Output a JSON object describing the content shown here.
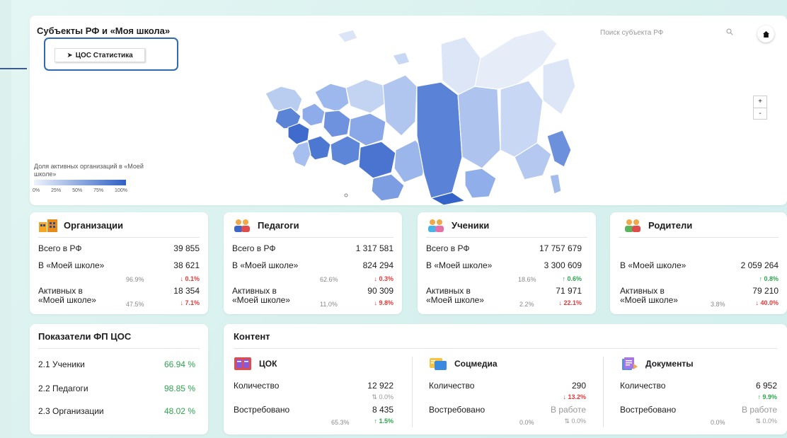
{
  "map": {
    "title": "Субъекты РФ и «Моя школа»",
    "cos_button_label": "ЦОС Статистика",
    "search_placeholder": "Поиск субъекта РФ",
    "zoom_in": "+",
    "zoom_out": "-",
    "legend_title": "Доля активных организаций в «Моей школе»",
    "legend_ticks": [
      "0%",
      "25%",
      "50%",
      "75%",
      "100%"
    ],
    "colors": {
      "low": "#eef3fb",
      "high": "#2f60c4"
    }
  },
  "stats": [
    {
      "title": "Организации",
      "icon": "building-icon",
      "total_label": "Всего в РФ",
      "total_value": "39 855",
      "in_label": "В «Моей школе»",
      "in_value": "38 621",
      "in_pct": "96.9%",
      "in_change": "0.1%",
      "active_label_1": "Активных в",
      "active_label_2": "«Моей школе»",
      "active_value": "18 354",
      "active_pct": "47.5%",
      "active_change": "7.1%"
    },
    {
      "title": "Педагоги",
      "icon": "teachers-icon",
      "total_label": "Всего в РФ",
      "total_value": "1 317 581",
      "in_label": "В «Моей школе»",
      "in_value": "824 294",
      "in_pct": "62.6%",
      "in_change": "0.3%",
      "active_label_1": "Активных в",
      "active_label_2": "«Моей школе»",
      "active_value": "90 309",
      "active_pct": "11.0%",
      "active_change": "9.8%"
    },
    {
      "title": "Ученики",
      "icon": "students-icon",
      "total_label": "Всего в РФ",
      "total_value": "17 757 679",
      "in_label": "В «Моей школе»",
      "in_value": "3 300 609",
      "in_pct": "18.6%",
      "in_change": "0.6%",
      "active_label_1": "Активных в",
      "active_label_2": "«Моей школе»",
      "active_value": "71 971",
      "active_pct": "2.2%",
      "active_change": "22.1%"
    },
    {
      "title": "Родители",
      "icon": "parents-icon",
      "in_label": "В «Моей школе»",
      "in_value": "2 059 264",
      "in_change": "0.8%",
      "active_label_1": "Активных в",
      "active_label_2": "«Моей школе»",
      "active_value": "79 210",
      "active_pct": "3.8%",
      "active_change": "40.0%"
    }
  ],
  "indicators": {
    "title": "Показатели ФП ЦОС",
    "rows": [
      {
        "label": "2.1 Ученики",
        "value": "66.94 %"
      },
      {
        "label": "2.2 Педагоги",
        "value": "98.85 %"
      },
      {
        "label": "2.3 Организации",
        "value": "48.02 %"
      }
    ]
  },
  "content": {
    "title": "Контент",
    "columns": [
      {
        "title": "ЦОК",
        "icon": "book-icon",
        "count_label": "Количество",
        "count_value": "12 922",
        "count_change": "0.0%",
        "demand_label": "Востребовано",
        "demand_value": "8 435",
        "demand_pct": "65.3%",
        "demand_change": "1.5%"
      },
      {
        "title": "Соцмедиа",
        "icon": "media-icon",
        "count_label": "Количество",
        "count_value": "290",
        "count_change": "13.2%",
        "demand_label": "Востребовано",
        "demand_value": "В работе",
        "demand_pct": "0.0%",
        "demand_change": "0.0%"
      },
      {
        "title": "Документы",
        "icon": "documents-icon",
        "count_label": "Количество",
        "count_value": "6 952",
        "count_change": "9.9%",
        "demand_label": "Востребовано",
        "demand_value": "В работе",
        "demand_pct": "0.0%",
        "demand_change": "0.0%"
      }
    ]
  }
}
